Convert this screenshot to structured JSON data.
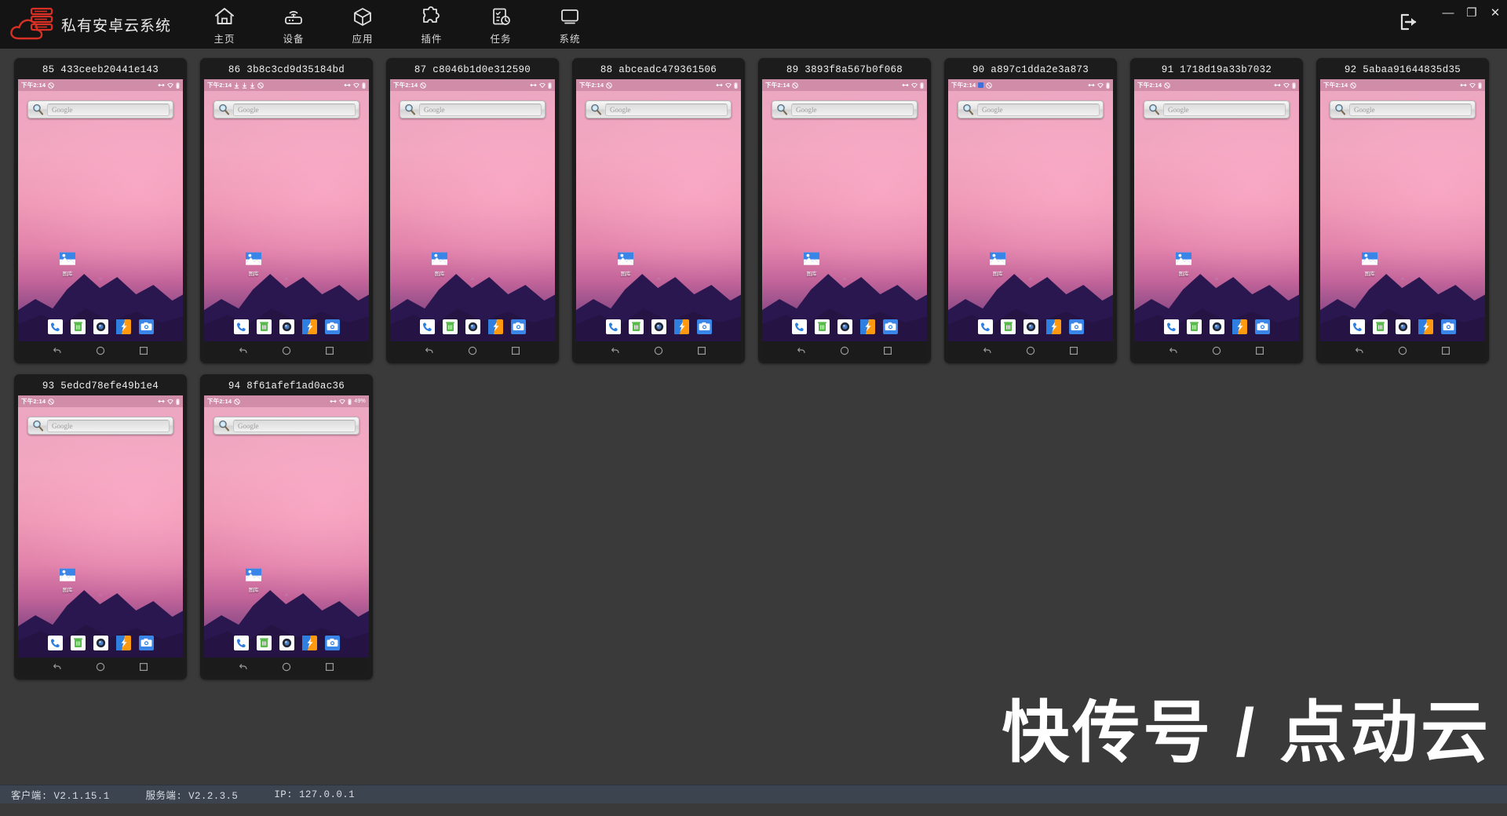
{
  "app": {
    "title": "私有安卓云系统",
    "logo_name": "cloud-server-logo"
  },
  "nav": [
    {
      "id": "home",
      "label": "主页",
      "icon": "home-icon"
    },
    {
      "id": "devices",
      "label": "设备",
      "icon": "router-icon"
    },
    {
      "id": "apps",
      "label": "应用",
      "icon": "cube-icon"
    },
    {
      "id": "plugins",
      "label": "插件",
      "icon": "puzzle-icon"
    },
    {
      "id": "tasks",
      "label": "任务",
      "icon": "clipboard-clock-icon"
    },
    {
      "id": "system",
      "label": "系统",
      "icon": "monitor-icon"
    }
  ],
  "window_controls": {
    "logout": "logout-icon",
    "minimize": "—",
    "maximize": "❐",
    "close": "✕"
  },
  "phone_common": {
    "time": "下午2:14",
    "search_placeholder": "Google",
    "gallery_label": "图库",
    "dock_apps": [
      "phone-icon",
      "messages-icon",
      "camera-lens-icon",
      "uc-browser-icon",
      "camera-icon"
    ],
    "nav_buttons": [
      "back-button",
      "home-button",
      "recents-button"
    ]
  },
  "devices": [
    {
      "num": "85",
      "id": "433ceeb20441e143",
      "title": "85 433ceeb20441e143",
      "downloads": 0,
      "battery_pct": "",
      "extra_badge": false
    },
    {
      "num": "86",
      "id": "3b8c3cd9d35184bd",
      "title": "86 3b8c3cd9d35184bd",
      "downloads": 3,
      "battery_pct": "",
      "extra_badge": false
    },
    {
      "num": "87",
      "id": "c8046b1d0e312590",
      "title": "87 c8046b1d0e312590",
      "downloads": 0,
      "battery_pct": "",
      "extra_badge": false
    },
    {
      "num": "88",
      "id": "abceadc479361506",
      "title": "88 abceadc479361506",
      "downloads": 0,
      "battery_pct": "",
      "extra_badge": false
    },
    {
      "num": "89",
      "id": "3893f8a567b0f068",
      "title": "89 3893f8a567b0f068",
      "downloads": 0,
      "battery_pct": "",
      "extra_badge": false
    },
    {
      "num": "90",
      "id": "a897c1dda2e3a873",
      "title": "90 a897c1dda2e3a873",
      "downloads": 0,
      "battery_pct": "",
      "extra_badge": true
    },
    {
      "num": "91",
      "id": "1718d19a33b7032",
      "title": "91 1718d19a33b7032",
      "downloads": 0,
      "battery_pct": "",
      "extra_badge": false
    },
    {
      "num": "92",
      "id": "5abaa91644835d35",
      "title": "92 5abaa91644835d35",
      "downloads": 0,
      "battery_pct": "",
      "extra_badge": false
    },
    {
      "num": "93",
      "id": "5edcd78efe49b1e4",
      "title": "93 5edcd78efe49b1e4",
      "downloads": 0,
      "battery_pct": "",
      "extra_badge": false
    },
    {
      "num": "94",
      "id": "8f61afef1ad0ac36",
      "title": "94 8f61afef1ad0ac36",
      "downloads": 0,
      "battery_pct": "49%",
      "extra_badge": false
    }
  ],
  "watermark": "快传号 / 点动云",
  "footer": {
    "client": "客户端: V2.1.15.1",
    "server": "服务端:  V2.2.3.5",
    "ip": "IP:  127.0.0.1"
  },
  "colors": {
    "topbar_bg": "#141414",
    "workspace_bg": "#3a3a3a",
    "card_bg": "#1c1c1c",
    "footer_bg": "#3c4450",
    "logo_red": "#d93025",
    "accent_blue": "#3f8ae0"
  }
}
